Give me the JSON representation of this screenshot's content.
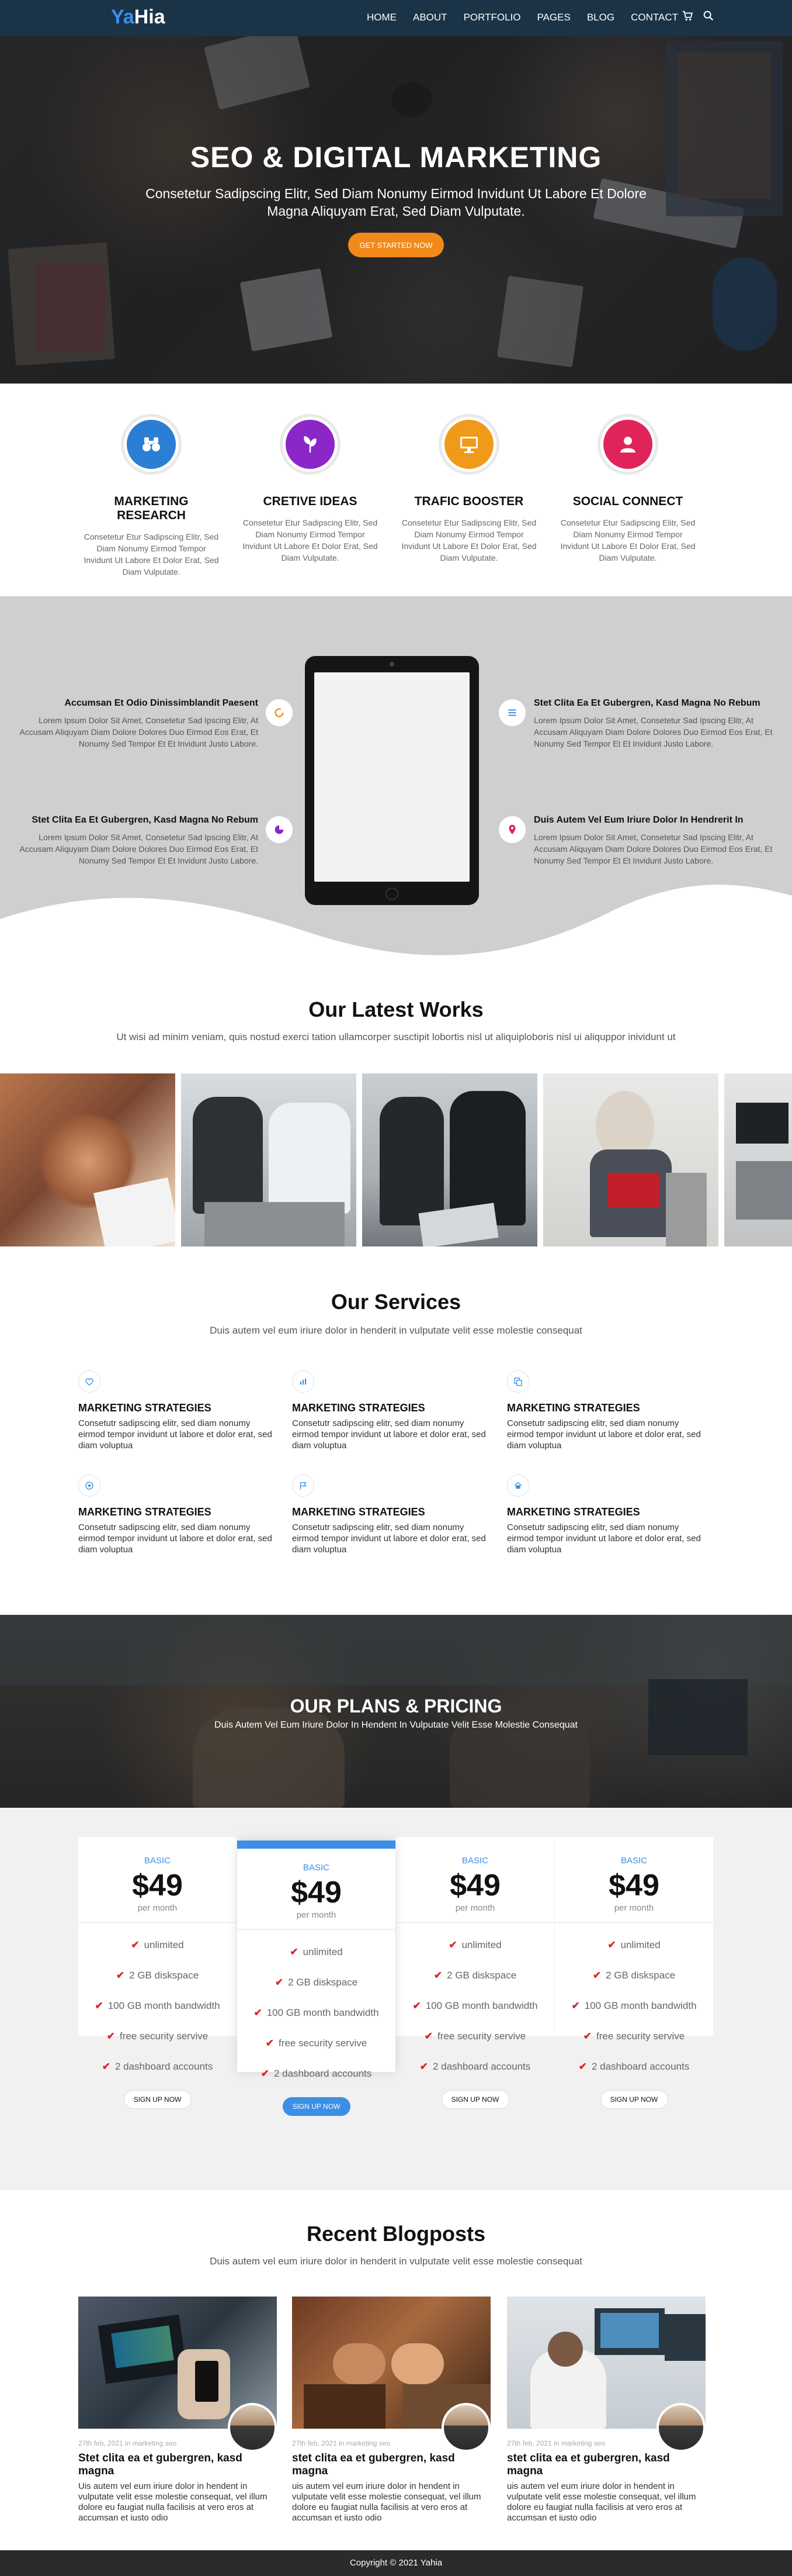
{
  "nav": {
    "logo_accent": "Ya",
    "logo_rest": "Hia",
    "items": [
      "HOME",
      "ABOUT",
      "PORTFOLIO",
      "PAGES",
      "BLOG",
      "CONTACT"
    ],
    "icons": [
      "cart-icon",
      "search-icon"
    ]
  },
  "hero": {
    "title": "SEO & DIGITAL MARKETING",
    "subtitle": "Consetetur Sadipscing Elitr, Sed Diam Nonumy Eirmod Invidunt Ut Labore Et Dolore Magna Aliquyam Erat, Sed Diam Vulputate.",
    "button": "GET STARTED NOW"
  },
  "features": [
    {
      "title": "MARKETING RESEARCH",
      "text": "Consetetur Etur Sadipscing Elitr, Sed Diam Nonumy Eirmod Tempor Invidunt Ut Labore Et Dolor Erat, Sed Diam Vulputate.",
      "color": "#2a7fd4",
      "icon": "binoculars-icon"
    },
    {
      "title": "CRETIVE IDEAS",
      "text": "Consetetur Etur Sadipscing Elitr, Sed Diam Nonumy Eirmod Tempor Invidunt Ut Labore Et Dolor Erat, Sed Diam Vulputate.",
      "color": "#8b26c9",
      "icon": "leaf-icon"
    },
    {
      "title": "TRAFIC BOOSTER",
      "text": "Consetetur Etur Sadipscing Elitr, Sed Diam Nonumy Eirmod Tempor Invidunt Ut Labore Et Dolor Erat, Sed Diam Vulputate.",
      "color": "#f09a1a",
      "icon": "monitor-icon"
    },
    {
      "title": "SOCIAL CONNECT",
      "text": "Consetetur Etur Sadipscing Elitr, Sed Diam Nonumy Eirmod Tempor Invidunt Ut Labore Et Dolor Erat, Sed Diam Vulputate.",
      "color": "#e0245a",
      "icon": "user-icon"
    }
  ],
  "app": {
    "items": [
      {
        "title": "Accumsan Et Odio Dinissimblandit Paesent",
        "text": "Lorem Ipsum Dolor Sit Amet, Consetetur Sad Ipscing Elitr, At Accusam Aliquyam Diam Dolore Dolores Duo Eirmod Eos Erat, Et Nonumy Sed Tempor Et Et Invidunt Justo Labore.",
        "icon": "circle-icon",
        "color": "#f28a1a"
      },
      {
        "title": "Stet Clita Ea Et Gubergren, Kasd Magna No Rebum",
        "text": "Lorem Ipsum Dolor Sit Amet, Consetetur Sad Ipscing Elitr, At Accusam Aliquyam Diam Dolore Dolores Duo Eirmod Eos Erat, Et Nonumy Sed Tempor Et Et Invidunt Justo Labore.",
        "icon": "list-icon",
        "color": "#3b8fe6"
      },
      {
        "title": "Stet Clita Ea Et Gubergren, Kasd Magna No Rebum",
        "text": "Lorem Ipsum Dolor Sit Amet, Consetetur Sad Ipscing Elitr, At Accusam Aliquyam Diam Dolore Dolores Duo Eirmod Eos Erat, Et Nonumy Sed Tempor Et Et Invidunt Justo Labore.",
        "icon": "pie-icon",
        "color": "#8b26c9"
      },
      {
        "title": "Duis Autem Vel Eum Iriure Dolor In Hendrerit In",
        "text": "Lorem Ipsum Dolor Sit Amet, Consetetur Sad Ipscing Elitr, At Accusam Aliquyam Diam Dolore Dolores Duo Eirmod Eos Erat, Et Nonumy Sed Tempor Et Et Invidunt Justo Labore.",
        "icon": "pin-icon",
        "color": "#e0245a"
      }
    ]
  },
  "works": {
    "title": "Our Latest Works",
    "subtitle": "Ut wisi ad minim veniam, quis nostud exerci tation ullamcorper susctipit lobortis nisl ut aliquiploboris nisl ui aliquppor inividunt ut"
  },
  "services": {
    "title": "Our Services",
    "subtitle": "Duis autem vel eum iriure dolor in henderit in vulputate velit esse molestie consequat",
    "items": [
      {
        "title": "MARKETING STRATEGIES",
        "text": "Consetutr sadipscing elitr, sed diam nonumy eirmod tempor invidunt ut labore et dolor erat, sed diam voluptua",
        "icon": "heart-icon"
      },
      {
        "title": "MARKETING STRATEGIES",
        "text": "Consetutr sadipscing elitr, sed diam nonumy eirmod tempor invidunt ut labore et dolor erat, sed diam voluptua",
        "icon": "chart-icon"
      },
      {
        "title": "MARKETING STRATEGIES",
        "text": "Consetutr sadipscing elitr, sed diam nonumy eirmod tempor invidunt ut labore et dolor erat, sed diam voluptua",
        "icon": "copy-icon"
      },
      {
        "title": "MARKETING STRATEGIES",
        "text": "Consetutr sadipscing elitr, sed diam nonumy eirmod tempor invidunt ut labore et dolor erat, sed diam voluptua",
        "icon": "target-icon"
      },
      {
        "title": "MARKETING STRATEGIES",
        "text": "Consetutr sadipscing elitr, sed diam nonumy eirmod tempor invidunt ut labore et dolor erat, sed diam voluptua",
        "icon": "flag-icon"
      },
      {
        "title": "MARKETING STRATEGIES",
        "text": "Consetutr sadipscing elitr, sed diam nonumy eirmod tempor invidunt ut labore et dolor erat, sed diam voluptua",
        "icon": "home-icon"
      }
    ]
  },
  "plans": {
    "title": "OUR PLANS & PRICING",
    "subtitle": "Duis Autem Vel Eum Iriure Dolor In Hendent In Vulputate Velit Esse Molestie Consequat"
  },
  "pricing": {
    "plans": [
      {
        "name": "BASIC",
        "price": "$49",
        "period": "per month",
        "features": [
          "unlimited",
          "2 GB diskspace",
          "100 GB month bandwidth",
          "free security servive",
          "2 dashboard accounts"
        ],
        "button": "SIGN UP NOW"
      },
      {
        "name": "BASIC",
        "price": "$49",
        "period": "per month",
        "features": [
          "unlimited",
          "2 GB diskspace",
          "100 GB month bandwidth",
          "free security servive",
          "2 dashboard accounts"
        ],
        "button": "SIGN UP NOW"
      },
      {
        "name": "BASIC",
        "price": "$49",
        "period": "per month",
        "features": [
          "unlimited",
          "2 GB diskspace",
          "100 GB month bandwidth",
          "free security servive",
          "2 dashboard accounts"
        ],
        "button": "SIGN UP NOW"
      },
      {
        "name": "BASIC",
        "price": "$49",
        "period": "per month",
        "features": [
          "unlimited",
          "2 GB diskspace",
          "100 GB month bandwidth",
          "free security servive",
          "2 dashboard accounts"
        ],
        "button": "SIGN UP NOW"
      }
    ]
  },
  "blog": {
    "title": "Recent Blogposts",
    "subtitle": "Duis autem vel eum iriure dolor in henderit in vulputate velit esse molestie consequat",
    "posts": [
      {
        "meta": "27th feb, 2021 in marketing seo",
        "title": "Stet clita ea et gubergren, kasd magna",
        "text": "Uis autem vel eum iriure dolor in hendent in vulputate velit esse molestie consequat, vel illum dolore eu faugiat nulla facilisis at vero eros at accumsan et iusto odio"
      },
      {
        "meta": "27th feb, 2021 in marketing seo",
        "title": "stet clita ea et gubergren, kasd magna",
        "text": "uis autem vel eum iriure dolor in hendent in vulputate velit esse molestie consequat, vel illum dolore eu faugiat nulla facilisis at vero eros at accumsan et iusto odio"
      },
      {
        "meta": "27th feb, 2021 in marketing seo",
        "title": "stet clita ea et gubergren, kasd magna",
        "text": "uis autem vel eum iriure dolor in hendent in vulputate velit esse molestie consequat, vel illum dolore eu faugiat nulla facilisis at vero eros at accumsan et iusto odio"
      }
    ]
  },
  "footer": {
    "copyright": "Copyright © 2021 Yahia"
  }
}
